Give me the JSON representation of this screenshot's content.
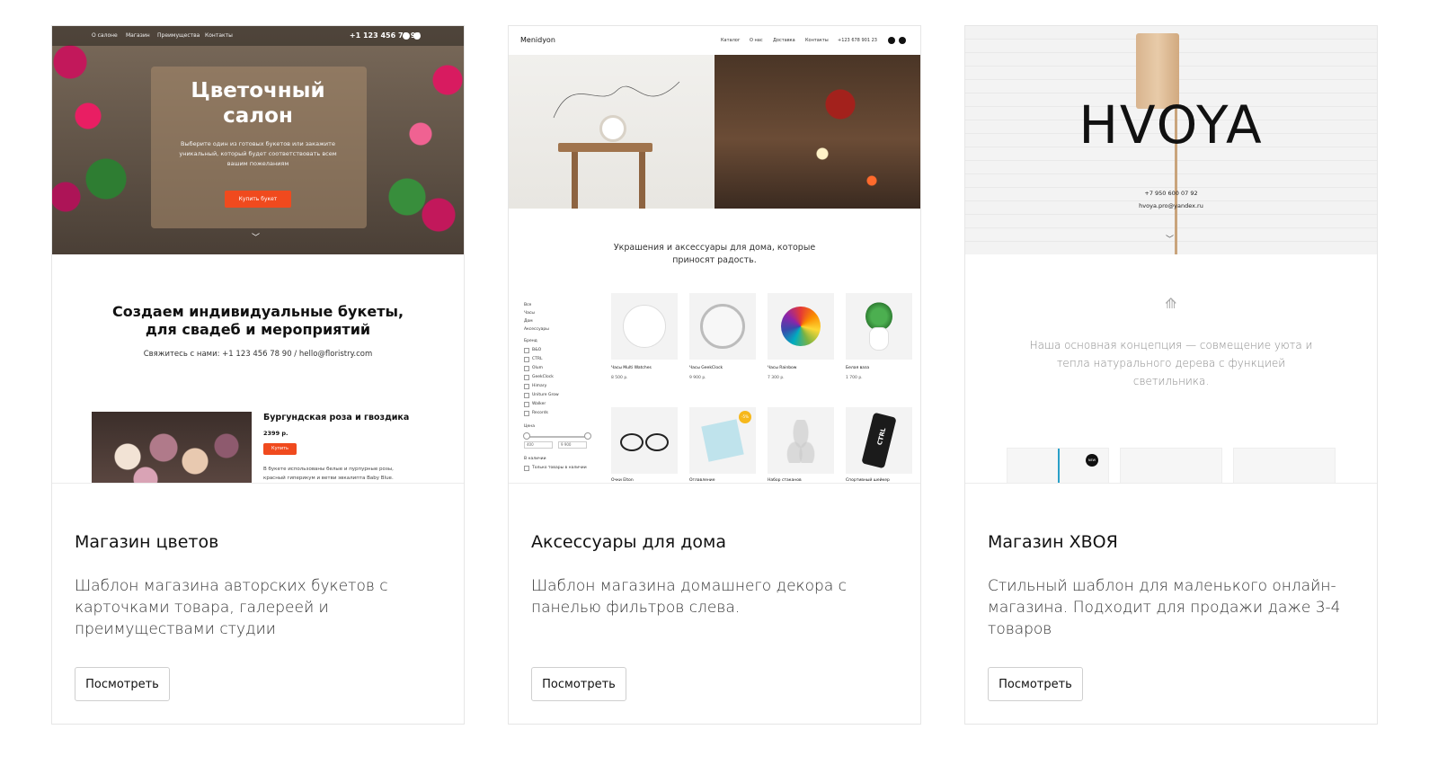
{
  "cards": [
    {
      "title": "Магазин цветов",
      "description": "Шаблон магазина авторских букетов с карточками товара, галереей и преимуществами студии",
      "button_label": "Посмотреть",
      "preview": {
        "nav": [
          "О салоне",
          "Магазин",
          "Преимущества",
          "Контакты"
        ],
        "phone": "+1 123 456 78 90",
        "hero_title_line1": "Цветочный",
        "hero_title_line2": "салон",
        "hero_subtitle": "Выберите один из готовых букетов или закажите уникальный, который будет соответствовать всем вашим пожеланиям",
        "hero_cta": "Купить букет",
        "section_title_line1": "Создаем индивидуальные букеты,",
        "section_title_line2": "для свадеб и мероприятий",
        "contact_line": "Свяжитесь с нами: +1 123 456 78 90 / hello@floristry.com",
        "product_title": "Бургундская роза и гвоздика",
        "product_price": "2399 р.",
        "product_buy": "Купить",
        "product_desc": "В букете использованы белые и пурпурные розы, красный гиперикум и ветви эвкалипта Baby Blue."
      }
    },
    {
      "title": "Аксессуары для дома",
      "description": "Шаблон магазина домашнего декора с панелью фильтров слева.",
      "button_label": "Посмотреть",
      "preview": {
        "logo": "Menidyon",
        "nav": [
          "Каталог",
          "О нас",
          "Доставка",
          "Контакты",
          "+123 678 901 23"
        ],
        "tagline_line1": "Украшения и аксессуары для дома, которые",
        "tagline_line2": "приносят радость.",
        "categories": [
          "Все",
          "Часы",
          "Дом",
          "Аксессуары"
        ],
        "brand_label": "Бренд",
        "brands": [
          "B&O",
          "CTRL",
          "Olum",
          "GeekClock",
          "Himary",
          "Uniture Grow",
          "Walker",
          "Records"
        ],
        "price_label": "Цена",
        "price_from": "400",
        "price_to": "9 900",
        "stock_label": "В наличии",
        "stock_option": "Только товары в наличии",
        "sale_badge": "-5%",
        "products": [
          {
            "name": "Часы Multi Watches",
            "price": "8 500 р."
          },
          {
            "name": "Часы GeekClock",
            "price": "9 900 р."
          },
          {
            "name": "Часы Rainbow",
            "price": "7 300 р."
          },
          {
            "name": "Белая ваза",
            "price": "1 700 р."
          },
          {
            "name": "Очки Elton",
            "price": ""
          },
          {
            "name": "Оглавление",
            "price": ""
          },
          {
            "name": "Набор стаканов",
            "price": ""
          },
          {
            "name": "Спортивный шейкер",
            "price": ""
          }
        ],
        "shaker_text": "CTRL"
      }
    },
    {
      "title": "Магазин ХВОЯ",
      "description": "Стильный шаблон для маленького онлайн-магазина. Подходит для продажи даже 3-4 товаров",
      "button_label": "Посмотреть",
      "preview": {
        "logo": "HVOYA",
        "phone": "+7 950 600 07 92",
        "email": "hvoya.pro@yandex.ru",
        "concept": "Наша основная концепция — совмещение уюта и тепла натурального дерева с функцией светильника.",
        "badge": "NEW"
      }
    }
  ],
  "colors": {
    "accent_orange": "#f04a1e",
    "sale_yellow": "#f6b81c",
    "card_border": "#e6e6e6"
  }
}
